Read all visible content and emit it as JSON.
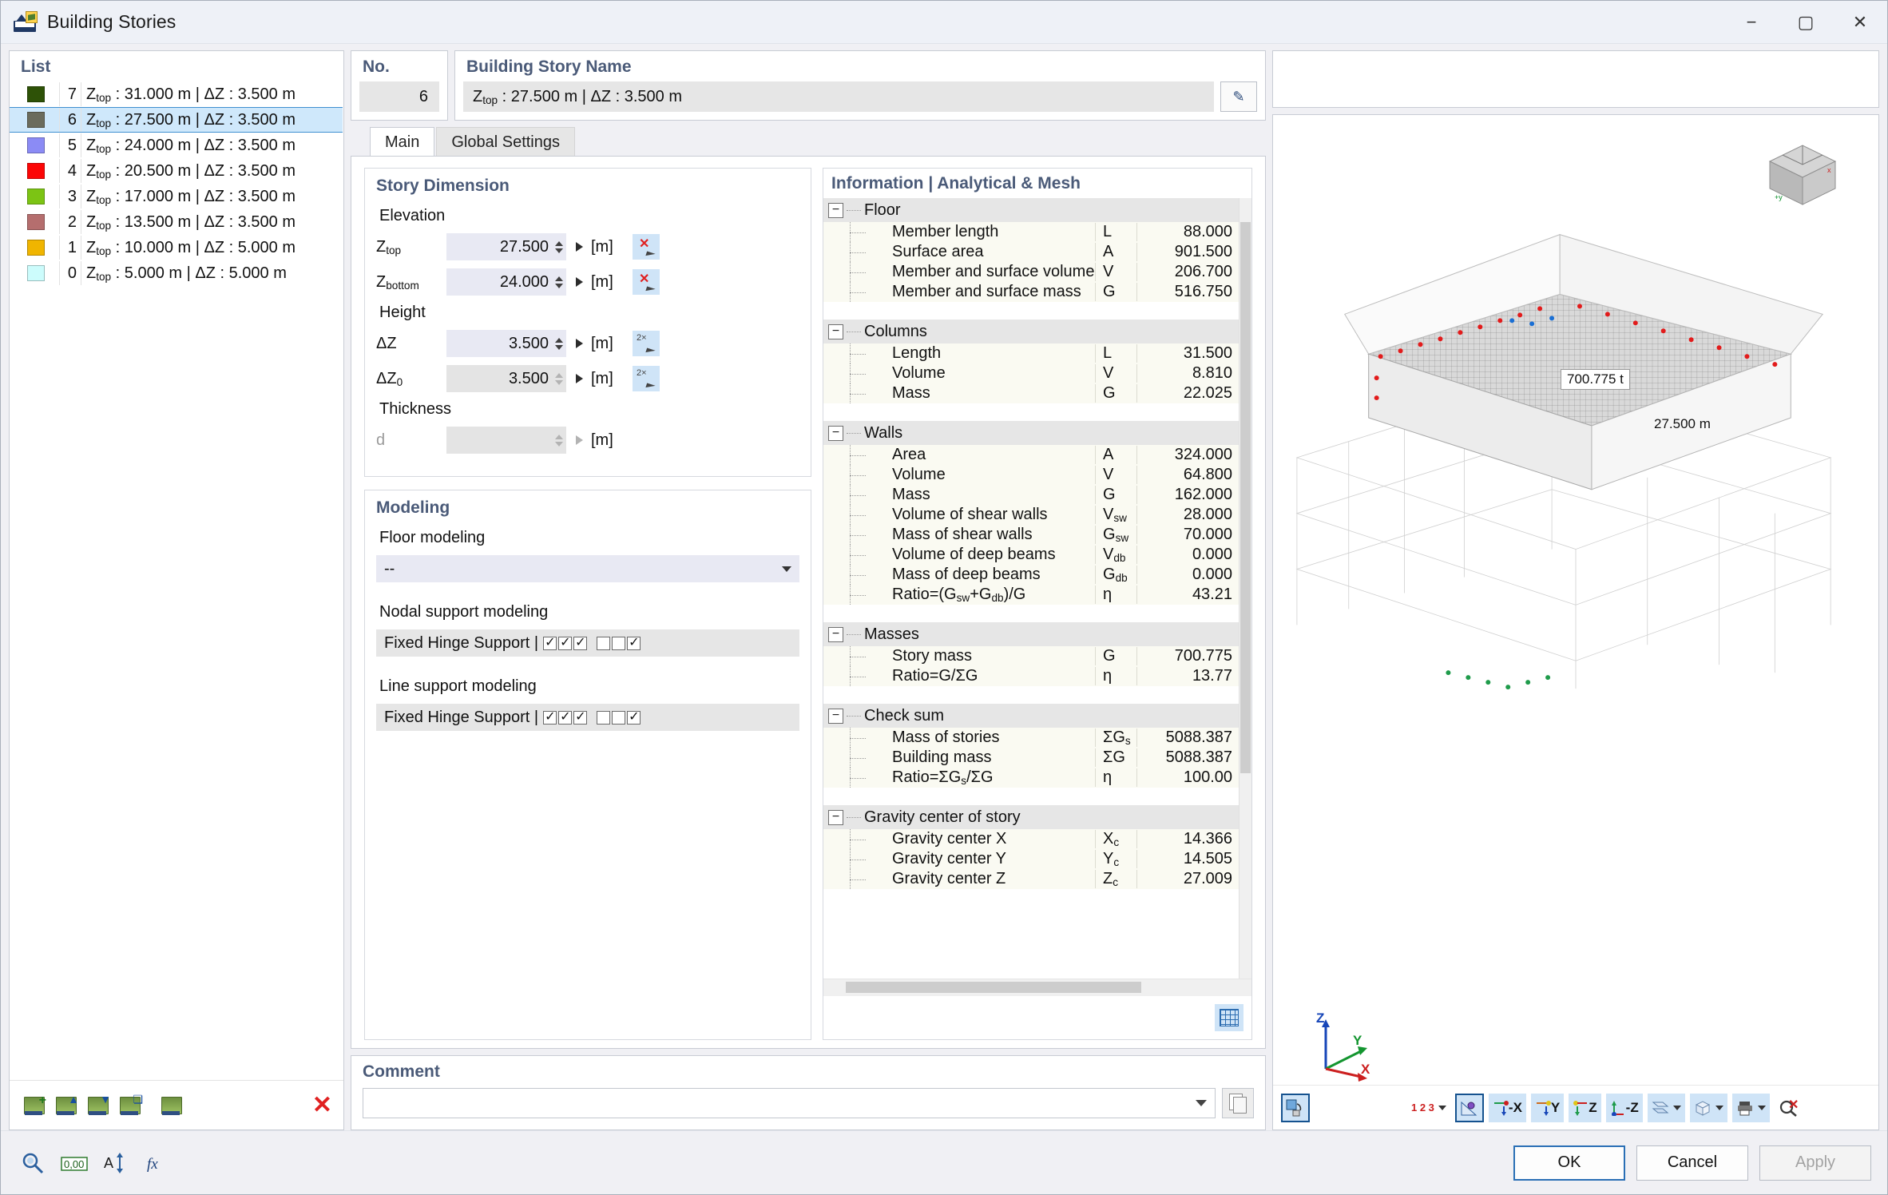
{
  "window": {
    "title": "Building Stories",
    "icon": "building-stories-icon",
    "minimize": "−",
    "maximize": "▢",
    "close": "✕"
  },
  "list": {
    "title": "List",
    "rows": [
      {
        "color": "#2e5207",
        "num": "7",
        "ztop": "31.000",
        "dz": "3.500"
      },
      {
        "color": "#6b6b5c",
        "num": "6",
        "ztop": "27.500",
        "dz": "3.500"
      },
      {
        "color": "#8b8bf5",
        "num": "5",
        "ztop": "24.000",
        "dz": "3.500"
      },
      {
        "color": "#fc0505",
        "num": "4",
        "ztop": "20.500",
        "dz": "3.500"
      },
      {
        "color": "#7cc414",
        "num": "3",
        "ztop": "17.000",
        "dz": "3.500"
      },
      {
        "color": "#b56e6e",
        "num": "2",
        "ztop": "13.500",
        "dz": "3.500"
      },
      {
        "color": "#f0b500",
        "num": "1",
        "ztop": "10.000",
        "dz": "5.000"
      },
      {
        "color": "#ccfcfc",
        "num": "0",
        "ztop": "5.000",
        "dz": "5.000"
      }
    ],
    "selected_index": 1,
    "row_template_prefix": "Z",
    "row_template_sub": "top",
    "row_template_mid": " : ",
    "row_template_unit": " m | ΔZ : ",
    "row_template_suffix": " m",
    "toolbar": {
      "new_story": "new-story-icon",
      "insert_above": "insert-story-above-icon",
      "insert_below": "insert-story-below-icon",
      "duplicate": "duplicate-story-icon",
      "renumber": "renumber-stories-icon",
      "delete": "✕"
    }
  },
  "no_panel": {
    "title": "No.",
    "value": "6"
  },
  "name_panel": {
    "title": "Building Story Name",
    "value_prefix": "Z",
    "value_sub": "top",
    "value": "Ztop : 27.500 m | ΔZ : 3.500 m",
    "edit_icon": "edit-name-icon"
  },
  "tabs": [
    {
      "label": "Main",
      "active": true
    },
    {
      "label": "Global Settings",
      "active": false
    }
  ],
  "story_dimension": {
    "title": "Story Dimension",
    "elevation_label": "Elevation",
    "height_label": "Height",
    "thickness_label": "Thickness",
    "unit": "[m]",
    "fields": [
      {
        "label": "Ztop",
        "sub": "top",
        "value": "27.500",
        "unit": "[m]",
        "disabled": false,
        "pick": true
      },
      {
        "label": "Zbottom",
        "sub": "bottom",
        "value": "24.000",
        "unit": "[m]",
        "disabled": false,
        "pick": true
      },
      {
        "label": "ΔZ",
        "sub": "",
        "value": "3.500",
        "unit": "[m]",
        "disabled": false,
        "pick": true
      },
      {
        "label": "ΔZ0",
        "sub": "0",
        "value": "3.500",
        "unit": "[m]",
        "disabled": true,
        "pick": true
      },
      {
        "label": "d",
        "sub": "",
        "value": "",
        "unit": "[m]",
        "disabled": true,
        "pick": false
      }
    ]
  },
  "modeling": {
    "title": "Modeling",
    "floor_modeling_label": "Floor modeling",
    "floor_modeling_value": "--",
    "nodal_support_label": "Nodal support modeling",
    "nodal_support_value": "Fixed Hinge Support |",
    "line_support_label": "Line support modeling",
    "line_support_value": "Fixed Hinge Support |",
    "checks": [
      true,
      true,
      true,
      false,
      false,
      true
    ]
  },
  "information": {
    "title": "Information | Analytical & Mesh",
    "groups": [
      {
        "name": "Floor",
        "rows": [
          {
            "name": "Member length",
            "sym": "L",
            "sub": "",
            "value": "88.000"
          },
          {
            "name": "Surface area",
            "sym": "A",
            "sub": "",
            "value": "901.500"
          },
          {
            "name": "Member and surface volume",
            "sym": "V",
            "sub": "",
            "value": "206.700"
          },
          {
            "name": "Member and surface mass",
            "sym": "G",
            "sub": "",
            "value": "516.750"
          }
        ]
      },
      {
        "name": "Columns",
        "rows": [
          {
            "name": "Length",
            "sym": "L",
            "sub": "",
            "value": "31.500"
          },
          {
            "name": "Volume",
            "sym": "V",
            "sub": "",
            "value": "8.810"
          },
          {
            "name": "Mass",
            "sym": "G",
            "sub": "",
            "value": "22.025"
          }
        ]
      },
      {
        "name": "Walls",
        "rows": [
          {
            "name": "Area",
            "sym": "A",
            "sub": "",
            "value": "324.000"
          },
          {
            "name": "Volume",
            "sym": "V",
            "sub": "",
            "value": "64.800"
          },
          {
            "name": "Mass",
            "sym": "G",
            "sub": "",
            "value": "162.000"
          },
          {
            "name": "Volume of shear walls",
            "sym": "V",
            "sub": "sw",
            "value": "28.000"
          },
          {
            "name": "Mass of shear walls",
            "sym": "G",
            "sub": "sw",
            "value": "70.000"
          },
          {
            "name": "Volume of deep beams",
            "sym": "V",
            "sub": "db",
            "value": "0.000"
          },
          {
            "name": "Mass of deep beams",
            "sym": "G",
            "sub": "db",
            "value": "0.000"
          },
          {
            "name": "Ratio=(Gsw+Gdb)/G",
            "sym": "η",
            "sub": "",
            "value": "43.21"
          }
        ]
      },
      {
        "name": "Masses",
        "rows": [
          {
            "name": "Story mass",
            "sym": "G",
            "sub": "",
            "value": "700.775"
          },
          {
            "name": "Ratio=G/ΣG",
            "sym": "η",
            "sub": "",
            "value": "13.77"
          }
        ]
      },
      {
        "name": "Check sum",
        "rows": [
          {
            "name": "Mass of stories",
            "sym": "ΣG",
            "sub": "s",
            "value": "5088.387"
          },
          {
            "name": "Building mass",
            "sym": "ΣG",
            "sub": "",
            "value": "5088.387"
          },
          {
            "name": "Ratio=ΣGs/ΣG",
            "sym": "η",
            "sub": "",
            "value": "100.00"
          }
        ]
      },
      {
        "name": "Gravity center of story",
        "rows": [
          {
            "name": "Gravity center X",
            "sym": "X",
            "sub": "c",
            "value": "14.366"
          },
          {
            "name": "Gravity center Y",
            "sym": "Y",
            "sub": "c",
            "value": "14.505"
          },
          {
            "name": "Gravity center Z",
            "sym": "Z",
            "sub": "c",
            "value": "27.009"
          }
        ]
      }
    ],
    "table_button": "info-table-icon"
  },
  "comment": {
    "title": "Comment",
    "value": "",
    "placeholder": "",
    "copy_icon": "copy-icon"
  },
  "viewport": {
    "mass_tag": "700.775 t",
    "elev_tag": "27.500 m",
    "axis": {
      "z": "Z",
      "y": "Y",
      "x": "X"
    },
    "nav_cube": "navigation-cube",
    "toolbar": [
      {
        "name": "render-mode-button",
        "icon": "render-mode-icon",
        "selected": true,
        "dropdown": false
      },
      {
        "name": "numbering-button",
        "icon": "numbering-icon",
        "label": "1 2 3",
        "selected": false,
        "dropdown": true
      },
      {
        "name": "measure-button",
        "icon": "measure-icon",
        "selected": true,
        "dropdown": false
      },
      {
        "name": "view-minus-x-button",
        "icon": "view-x-icon",
        "label": "-X",
        "selected": false,
        "dropdown": false
      },
      {
        "name": "view-y-button",
        "icon": "view-y-icon",
        "label": "Y",
        "selected": false,
        "dropdown": false
      },
      {
        "name": "view-z-button",
        "icon": "view-z-icon",
        "label": "Z",
        "selected": false,
        "dropdown": false
      },
      {
        "name": "view-minus-z-button",
        "icon": "view-minus-z-icon",
        "label": "-Z",
        "selected": false,
        "dropdown": false
      },
      {
        "name": "section-button",
        "icon": "section-icon",
        "selected": false,
        "dropdown": true
      },
      {
        "name": "box-view-button",
        "icon": "box-view-icon",
        "selected": false,
        "dropdown": true
      },
      {
        "name": "print-button",
        "icon": "print-icon",
        "selected": false,
        "dropdown": true
      },
      {
        "name": "clear-selection-button",
        "icon": "clear-selection-icon",
        "selected": false,
        "dropdown": false
      }
    ]
  },
  "footer": {
    "icons": [
      {
        "name": "find-icon",
        "glyph": "🔍"
      },
      {
        "name": "units-icon",
        "glyph": "0,00"
      },
      {
        "name": "settings-icon",
        "glyph": "A↕"
      },
      {
        "name": "formula-icon",
        "glyph": "fx"
      }
    ],
    "ok": "OK",
    "cancel": "Cancel",
    "apply": "Apply"
  }
}
